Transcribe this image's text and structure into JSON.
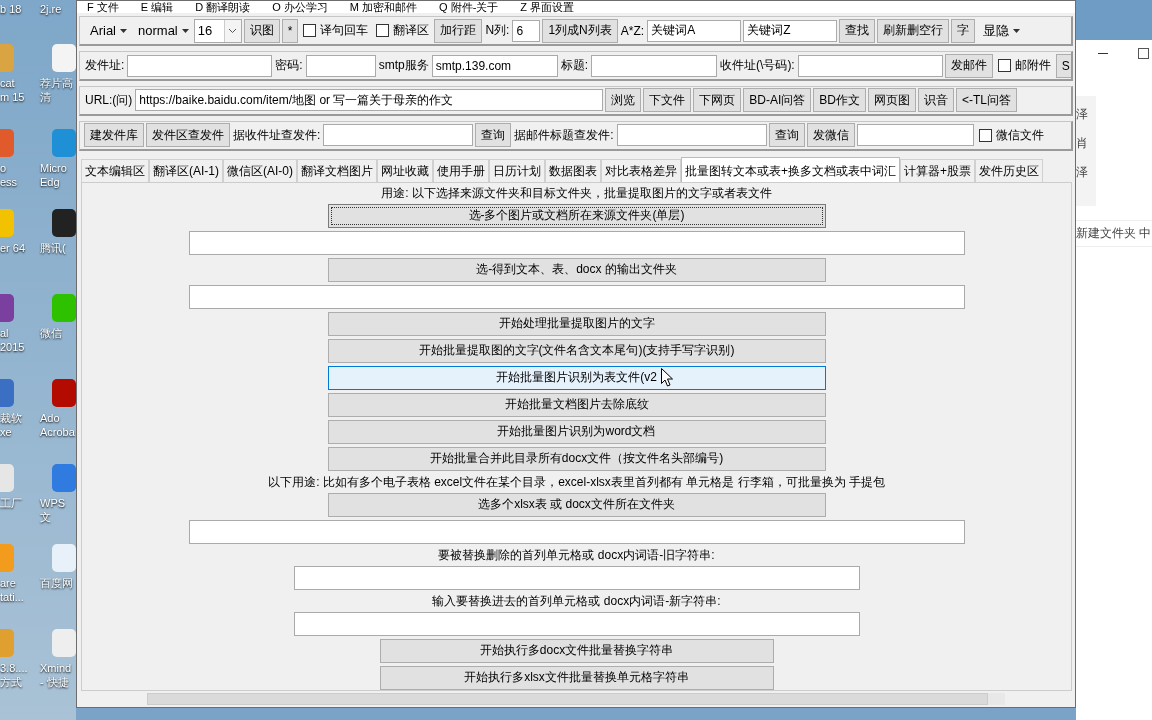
{
  "desktop": {
    "left_column": [
      {
        "kind": "caption",
        "label": "b 18"
      },
      {
        "kind": "shortcut",
        "label": "cat\nm 15",
        "color": "#d9a441"
      },
      {
        "kind": "shortcut",
        "label": "o\ness",
        "color": "#e05a2b"
      },
      {
        "kind": "shortcut",
        "label": "er 64",
        "color": "#f2c200"
      },
      {
        "kind": "shortcut",
        "label": "al\n2015",
        "color": "#7b3fa0"
      },
      {
        "kind": "shortcut",
        "label": "裁软\nxe",
        "color": "#3a6fc4"
      },
      {
        "kind": "shortcut",
        "label": "工厂",
        "color": "#e6e6e6"
      },
      {
        "kind": "shortcut",
        "label": "are\ntati...",
        "color": "#f29b1d"
      },
      {
        "kind": "shortcut",
        "label": "3.8....\n方式",
        "color": "#e0a030"
      }
    ],
    "right_column": [
      {
        "kind": "caption",
        "label": "2j.re"
      },
      {
        "kind": "shortcut",
        "label": "荐片高清",
        "color": "#f4f4f4"
      },
      {
        "kind": "shortcut",
        "label": "Micro\nEdg",
        "color": "#1f8fd6"
      },
      {
        "kind": "shortcut",
        "label": "腾讯(",
        "color": "#222222"
      },
      {
        "kind": "shortcut",
        "label": "微信",
        "color": "#2dc100"
      },
      {
        "kind": "shortcut",
        "label": "Ado\nAcroba",
        "color": "#b30b00"
      },
      {
        "kind": "shortcut",
        "label": "WPS文",
        "color": "#2f7be0"
      },
      {
        "kind": "shortcut",
        "label": "百度网",
        "color": "#e8f0fa"
      },
      {
        "kind": "shortcut",
        "label": "Xmind\n- 快捷",
        "color": "#eeeeee"
      }
    ]
  },
  "window": {
    "menu": [
      "F 文件",
      "E 编辑",
      "D 翻译朗读",
      "O 办公学习",
      "M 加密和邮件",
      "Q 附件-关于",
      "Z 界面设置"
    ],
    "toolbars": [
      {
        "items": [
          {
            "kind": "select",
            "text": "Arial"
          },
          {
            "kind": "select",
            "text": "normal"
          },
          {
            "kind": "combo",
            "value": "16"
          },
          {
            "kind": "button",
            "text": "识图"
          },
          {
            "kind": "button",
            "text": "*"
          },
          {
            "kind": "checkbox",
            "text": "译句回车",
            "checked": false
          },
          {
            "kind": "checkbox",
            "text": "翻译区",
            "checked": false
          },
          {
            "kind": "button",
            "text": "加行距"
          },
          {
            "kind": "label",
            "text": "N列:"
          },
          {
            "kind": "field",
            "value": "6"
          },
          {
            "kind": "button",
            "text": "1列成N列表"
          },
          {
            "kind": "label",
            "text": "A*Z:"
          },
          {
            "kind": "field",
            "value": "关键词A"
          },
          {
            "kind": "field",
            "value": "关键词Z"
          },
          {
            "kind": "button",
            "text": "查找"
          },
          {
            "kind": "button",
            "text": "刷新删空行"
          },
          {
            "kind": "button",
            "text": "字"
          },
          {
            "kind": "select",
            "text": "显隐"
          }
        ]
      },
      {
        "items": [
          {
            "kind": "label",
            "text": "发件址:"
          },
          {
            "kind": "field"
          },
          {
            "kind": "label",
            "text": "密码:"
          },
          {
            "kind": "field"
          },
          {
            "kind": "label",
            "text": "smtp服务"
          },
          {
            "kind": "field",
            "value": "smtp.139.com"
          },
          {
            "kind": "label",
            "text": "标题:"
          },
          {
            "kind": "field"
          },
          {
            "kind": "label",
            "text": "收件址(\\号码):"
          },
          {
            "kind": "field"
          },
          {
            "kind": "button",
            "text": "发邮件"
          },
          {
            "kind": "checkbox",
            "text": "邮附件",
            "checked": false
          },
          {
            "kind": "button",
            "text": "S"
          }
        ]
      },
      {
        "items": [
          {
            "kind": "label",
            "text": "URL:(问)"
          },
          {
            "kind": "field",
            "value": "https://baike.baidu.com/item/地图 or 写一篇关于母亲的作文"
          },
          {
            "kind": "button",
            "text": "浏览"
          },
          {
            "kind": "button",
            "text": "下文件"
          },
          {
            "kind": "button",
            "text": "下网页"
          },
          {
            "kind": "button",
            "text": "BD-AI问答"
          },
          {
            "kind": "button",
            "text": "BD作文"
          },
          {
            "kind": "button",
            "text": "网页图"
          },
          {
            "kind": "button",
            "text": "识音"
          },
          {
            "kind": "button",
            "text": "<-TL问答"
          }
        ]
      },
      {
        "items": [
          {
            "kind": "button",
            "text": "建发件库"
          },
          {
            "kind": "button",
            "text": "发件区查发件"
          },
          {
            "kind": "label",
            "text": "据收件址查发件:"
          },
          {
            "kind": "field"
          },
          {
            "kind": "button",
            "text": "查询"
          },
          {
            "kind": "label",
            "text": "据邮件标题查发件:"
          },
          {
            "kind": "field"
          },
          {
            "kind": "button",
            "text": "查询"
          },
          {
            "kind": "button",
            "text": "发微信"
          },
          {
            "kind": "field"
          },
          {
            "kind": "checkbox",
            "text": "微信文件",
            "checked": false
          }
        ]
      }
    ],
    "tabs": [
      {
        "label": "文本编辑区",
        "selected": false
      },
      {
        "label": "翻译区(AI-1)",
        "selected": false
      },
      {
        "label": "微信区(AI-0)",
        "selected": false
      },
      {
        "label": "翻译文档图片",
        "selected": false
      },
      {
        "label": "网址收藏",
        "selected": false
      },
      {
        "label": "使用手册",
        "selected": false
      },
      {
        "label": "日历计划",
        "selected": false
      },
      {
        "label": "数据图表",
        "selected": false
      },
      {
        "label": "对比表格差异",
        "selected": false
      },
      {
        "label": "批量图转文本或表+换多文档或表中词汇",
        "selected": true
      },
      {
        "label": "计算器+股票",
        "selected": false
      },
      {
        "label": "发件历史区",
        "selected": false
      }
    ],
    "content": [
      {
        "kind": "note",
        "text": "用途: 以下选择来源文件夹和目标文件夹，批量提取图片的文字或者表文件"
      },
      {
        "kind": "button",
        "text": "选-多个图片或文档所在来源文件夹(单层)",
        "focused": true,
        "hovered": false
      },
      {
        "kind": "field"
      },
      {
        "kind": "button",
        "text": "选-得到文本、表、docx 的输出文件夹",
        "focused": false,
        "hovered": false
      },
      {
        "kind": "field"
      },
      {
        "kind": "button",
        "text": "开始处理批量提取图片的文字",
        "focused": false,
        "hovered": false
      },
      {
        "kind": "button",
        "text": "开始批量提取图的文字(文件名含文本尾句)(支持手写字识别)",
        "focused": false,
        "hovered": false
      },
      {
        "kind": "button",
        "text": "开始批量图片识别为表文件(v2",
        "focused": false,
        "hovered": true
      },
      {
        "kind": "button",
        "text": "开始批量文档图片去除底纹",
        "focused": false,
        "hovered": false
      },
      {
        "kind": "button",
        "text": "开始批量图片识别为word文档",
        "focused": false,
        "hovered": false
      },
      {
        "kind": "button",
        "text": "开始批量合并此目录所有docx文件（按文件名头部编号)",
        "focused": false,
        "hovered": false
      },
      {
        "kind": "note",
        "text": "以下用途: 比如有多个电子表格 excel文件在某个目录，excel-xlsx表里首列都有 单元格是 行李箱，可批量换为 手提包"
      },
      {
        "kind": "button",
        "text": "选多个xlsx表 或 docx文件所在文件夹",
        "focused": false,
        "hovered": false
      },
      {
        "kind": "field"
      },
      {
        "kind": "note",
        "text": "要被替换删除的首列单元格或 docx内词语-旧字符串:"
      },
      {
        "kind": "field"
      },
      {
        "kind": "note",
        "text": "输入要替换进去的首列单元格或 docx内词语-新字符串:"
      },
      {
        "kind": "field"
      },
      {
        "kind": "button",
        "text": "开始执行多docx文件批量替换字符串",
        "focused": false,
        "hovered": false
      },
      {
        "kind": "button",
        "text": "开始执行多xlsx文件批量替换单元格字符串",
        "focused": false,
        "hovered": false
      }
    ]
  },
  "explorer": {
    "side_labels": [
      "泽",
      "肖",
      "泽"
    ],
    "item": "新建文件夹 中"
  }
}
